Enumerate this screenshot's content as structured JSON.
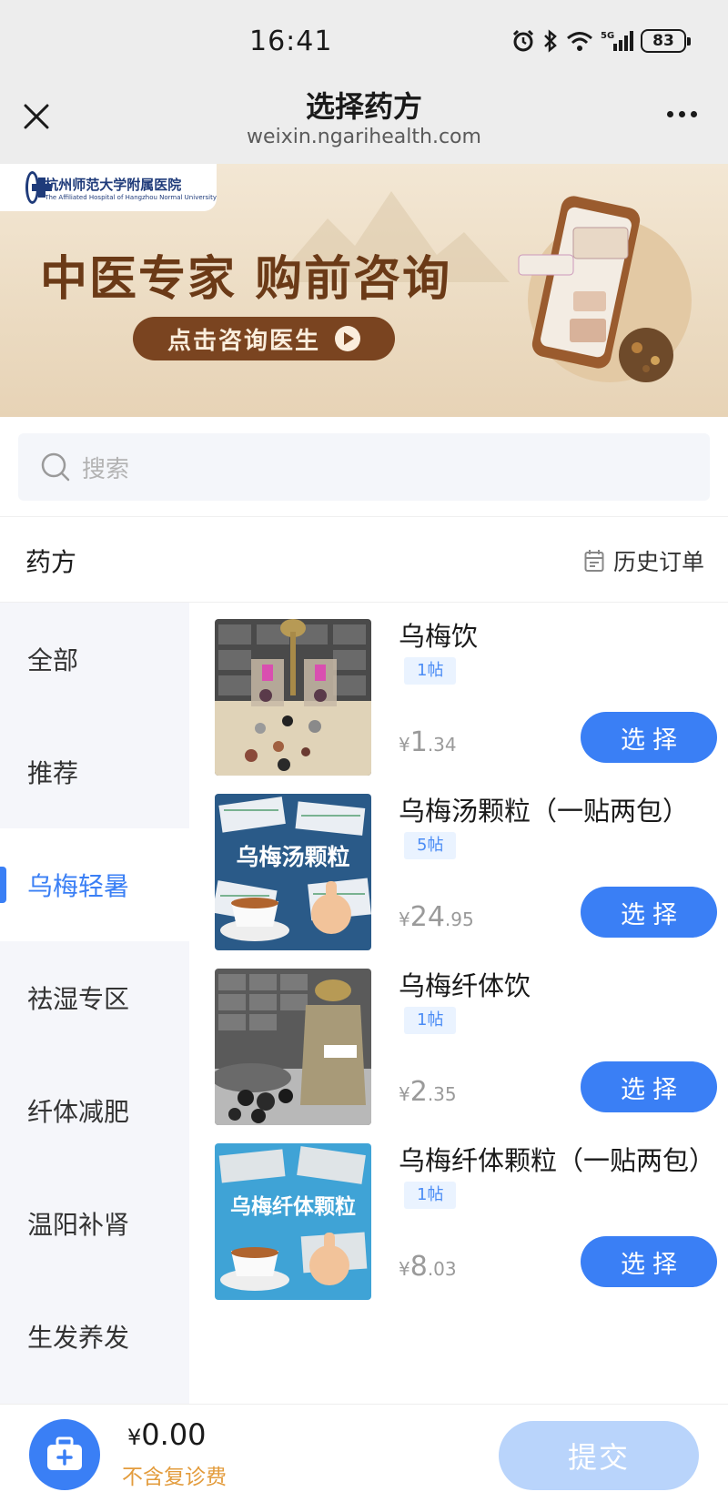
{
  "status_bar": {
    "time": "16:41",
    "battery": "83",
    "network": "5G"
  },
  "title_bar": {
    "title": "选择药方",
    "url": "weixin.ngarihealth.com"
  },
  "banner": {
    "hospital_name": "杭州师范大学附属医院",
    "hospital_name_en": "The Affiliated Hospital of Hangzhou Normal University",
    "headline": "中医专家  购前咨询",
    "cta_label": "点击咨询医生",
    "accent_color": "#7a4420"
  },
  "search": {
    "placeholder": "搜索"
  },
  "section": {
    "title": "药方",
    "history_label": "历史订单"
  },
  "sidebar": {
    "items": [
      {
        "label": "全部"
      },
      {
        "label": "推荐"
      },
      {
        "label": "乌梅轻暑",
        "active": true
      },
      {
        "label": "祛湿专区"
      },
      {
        "label": "纤体减肥"
      },
      {
        "label": "温阳补肾"
      },
      {
        "label": "生发养发"
      }
    ]
  },
  "products": [
    {
      "name": "乌梅饮",
      "tag": "1帖",
      "price_yen": "¥",
      "price_int": "1",
      "price_dec": ".34",
      "button": "选择",
      "image": "ingredients-photo"
    },
    {
      "name": "乌梅汤颗粒（一贴两包）",
      "tag": "5帖",
      "price_yen": "¥",
      "price_int": "24",
      "price_dec": ".95",
      "button": "选择",
      "image_text": "乌梅汤颗粒"
    },
    {
      "name": "乌梅纤体饮",
      "tag": "1帖",
      "price_yen": "¥",
      "price_int": "2",
      "price_dec": ".35",
      "button": "选择",
      "image": "ingredients-photo"
    },
    {
      "name": "乌梅纤体颗粒（一贴两包）",
      "tag": "1帖",
      "price_yen": "¥",
      "price_int": "8",
      "price_dec": ".03",
      "button": "选择",
      "image_text": "乌梅纤体颗粒"
    }
  ],
  "bottom_bar": {
    "yen": "¥",
    "total": "0.00",
    "fee_note": "不含复诊费",
    "submit_label": "提交"
  },
  "colors": {
    "primary": "#3a7ff5",
    "tag_bg": "#eaf3ff",
    "warning": "#e39c3d",
    "submit_disabled": "#b9d4fb"
  }
}
